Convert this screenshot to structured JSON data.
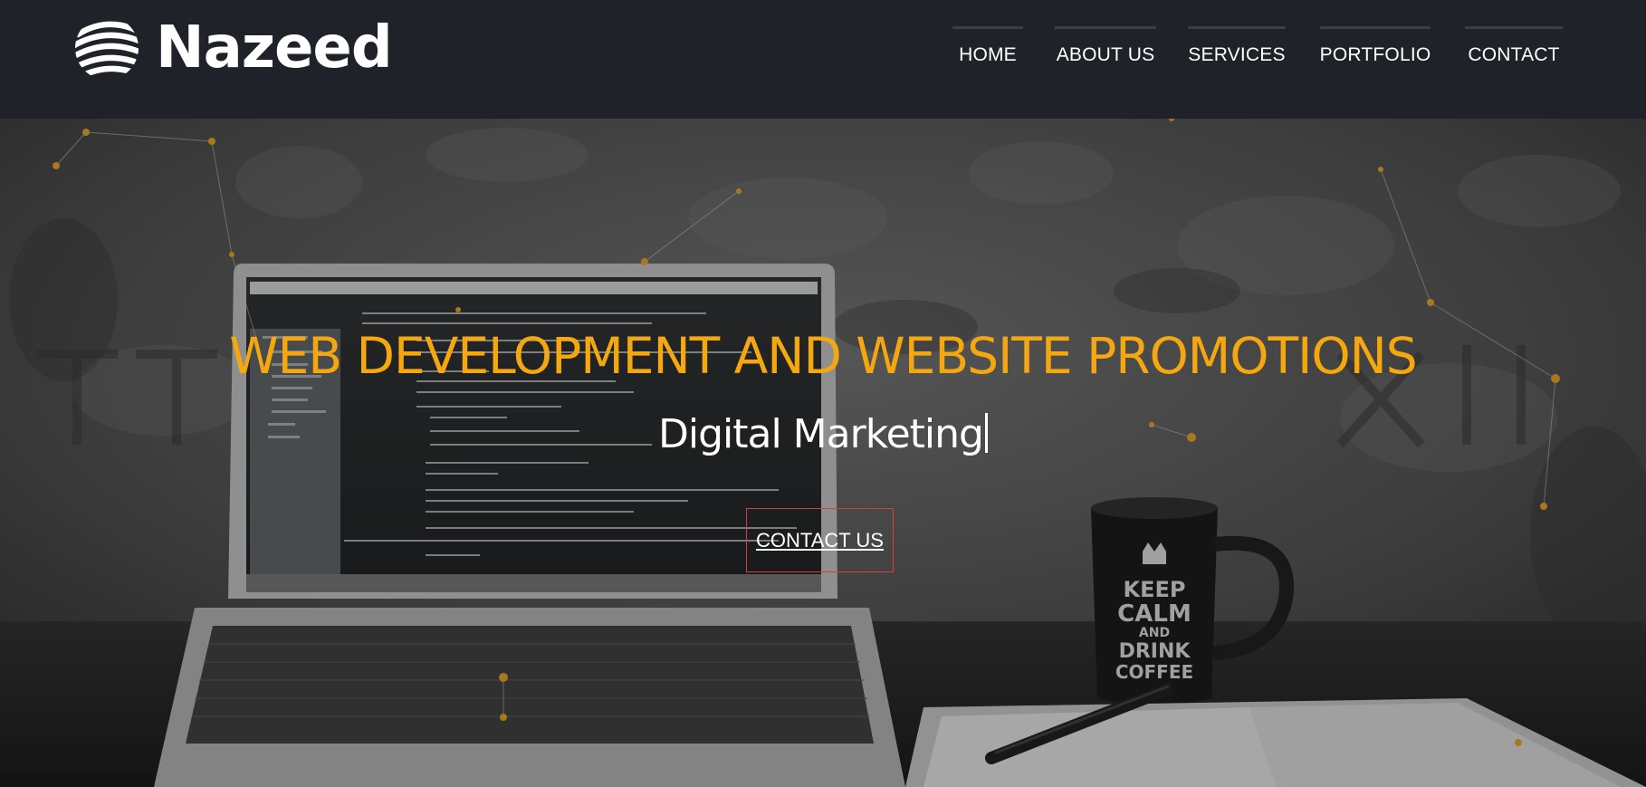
{
  "brand": {
    "name": "Nazeed",
    "logo_icon": "striped-globe-icon"
  },
  "nav": {
    "items": [
      {
        "label": "HOME"
      },
      {
        "label": "ABOUT US"
      },
      {
        "label": "SERVICES"
      },
      {
        "label": "PORTFOLIO"
      },
      {
        "label": "CONTACT"
      }
    ]
  },
  "hero": {
    "title": "WEB DEVELOPMENT AND WEBSITE PROMOTIONS",
    "subtitle": "Digital Marketing",
    "cta_label": "CONTACT US"
  },
  "colors": {
    "header_bg": "#1f2329",
    "accent": "#f5a70f",
    "cta_border": "#d04040",
    "text": "#ffffff"
  }
}
